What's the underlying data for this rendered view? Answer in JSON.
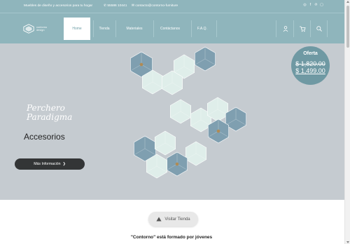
{
  "topbar": {
    "tagline": "Muebles de diseño y accesorios para tu hogar",
    "phone": "55586 10441",
    "email": "contacto@contorno-furniture",
    "socials": [
      "whatsapp-icon",
      "facebook-icon",
      "pinterest-icon",
      "instagram-icon"
    ]
  },
  "logo": {
    "text": "contorno design"
  },
  "nav": {
    "items": [
      {
        "label": "Home",
        "active": true
      },
      {
        "label": "Tienda",
        "active": false
      },
      {
        "label": "Materiales",
        "active": false
      },
      {
        "label": "Contáctanos",
        "active": false
      },
      {
        "label": "F.A.Q.",
        "active": false
      }
    ],
    "icons": [
      "user-icon",
      "cart-icon",
      "search-icon"
    ]
  },
  "hero": {
    "subtitle_line1": "Perchero",
    "subtitle_line2": "Paradigma",
    "title": "Accesorios",
    "button_label": "Más Información",
    "button_arrow": "❯"
  },
  "offer": {
    "label": "Oferta",
    "old_price": "$ 1,820.00",
    "new_price": "$ 1,499.00"
  },
  "cta": {
    "label": "Visitar Tienda"
  },
  "intro": {
    "line1": "\"Contorno\" está formado por jóvenes"
  },
  "colors": {
    "bar": "#8fb5bc",
    "hero_bg": "#c5cbd0",
    "hex_blue": "#7f9fb0",
    "hex_mint": "#dfeeea",
    "badge": "#6f99a3"
  }
}
